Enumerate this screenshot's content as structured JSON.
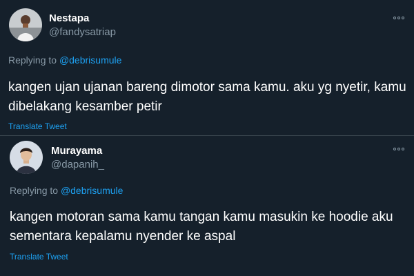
{
  "tweets": [
    {
      "name": "Nestapa",
      "handle": "@fandysatriap",
      "replying_prefix": "Replying to ",
      "replying_to": "@debrisumule",
      "text": "kangen ujan ujanan bareng dimotor sama kamu. aku yg nyetir, kamu dibelakang kesamber petir",
      "translate": "Translate Tweet",
      "avatar_icon": "profile-photo-man-outdoors"
    },
    {
      "name": "Murayama",
      "handle": "@dapanih_",
      "replying_prefix": "Replying to ",
      "replying_to": "@debrisumule",
      "text": "kangen motoran sama kamu tangan kamu masukin ke hoodie aku sementara kepalamu nyender ke aspal",
      "translate": "Translate Tweet",
      "avatar_icon": "profile-photo-young-man"
    }
  ],
  "colors": {
    "background": "#15202b",
    "secondary_text": "#8899a6",
    "link": "#1da1f2",
    "divider": "#38444d"
  },
  "icons": {
    "more": "more-options-icon"
  }
}
